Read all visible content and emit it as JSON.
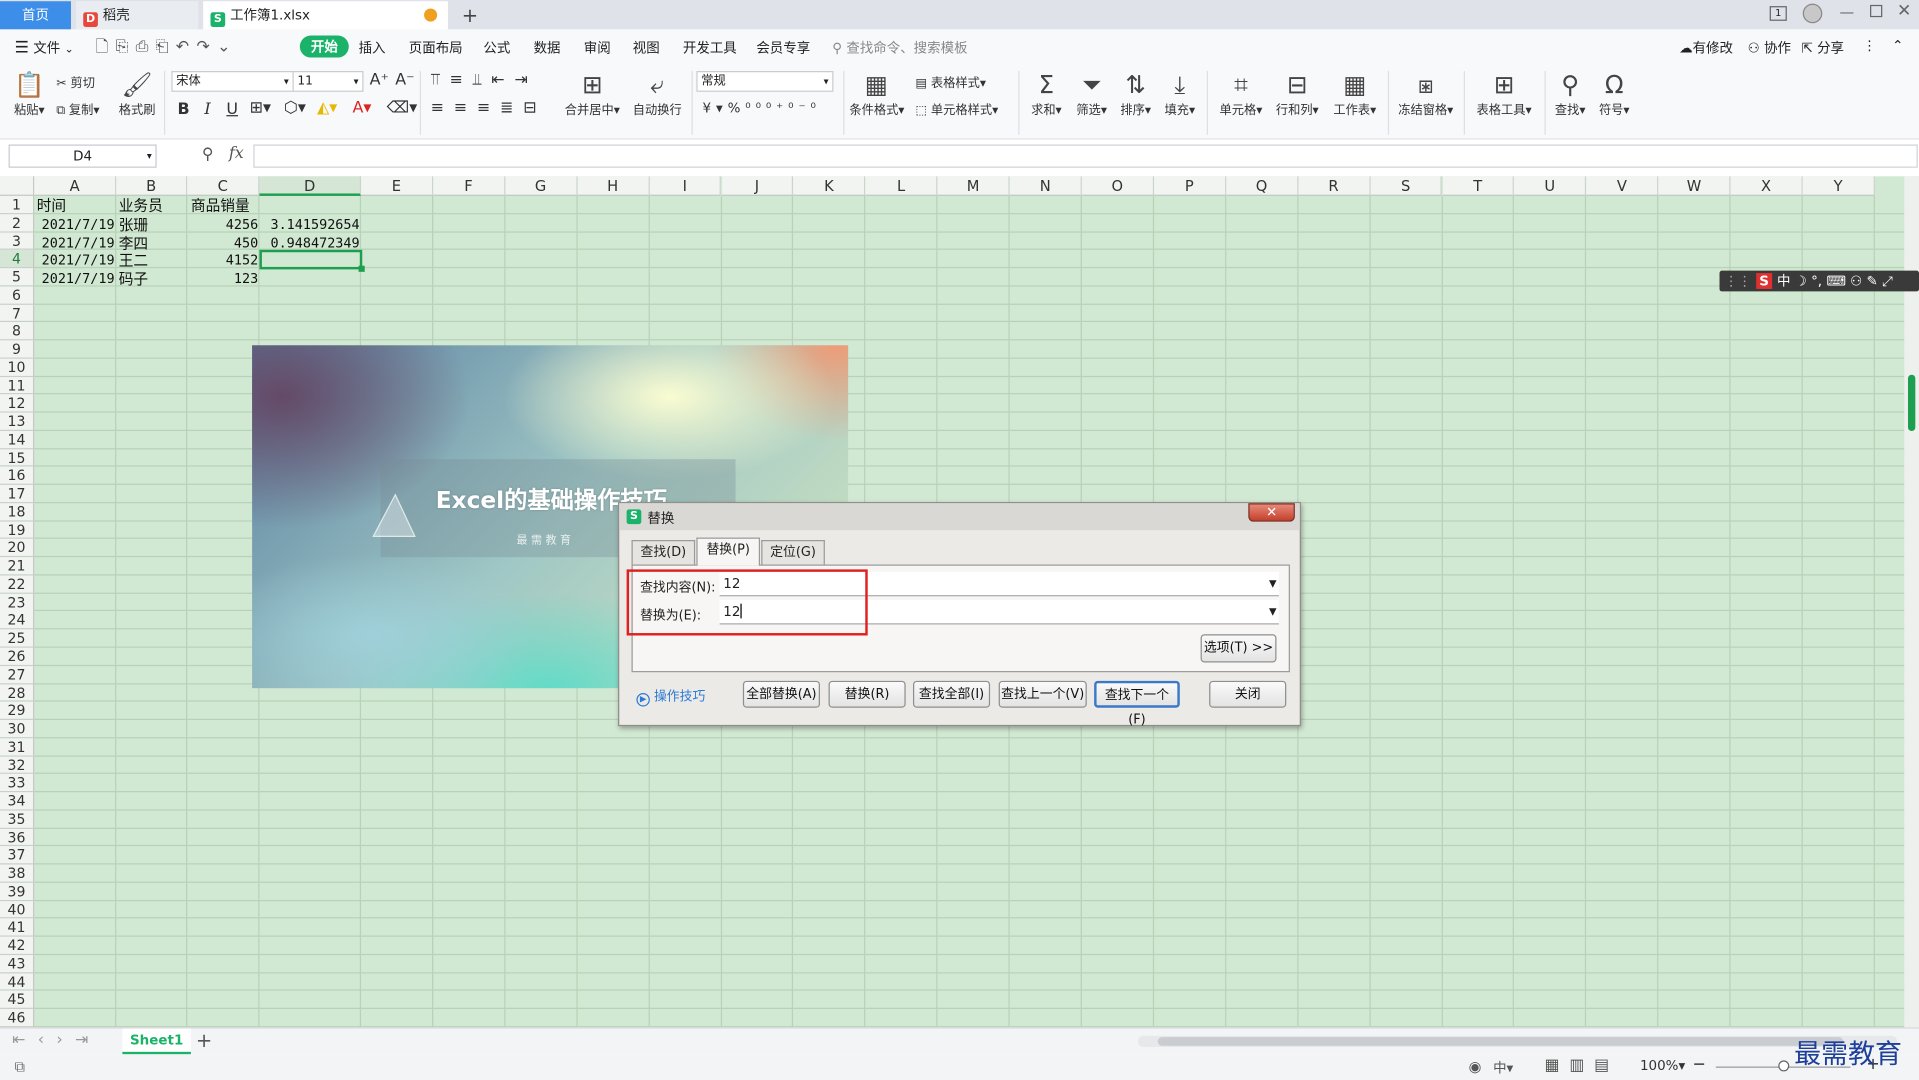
{
  "tabs": {
    "home": "首页",
    "docer": "稻壳",
    "file": "工作簿1.xlsx",
    "new_tab": "+"
  },
  "menu": {
    "file": "文件",
    "start": "开始",
    "insert": "插入",
    "layout": "页面布局",
    "formula": "公式",
    "data": "数据",
    "review": "审阅",
    "view": "视图",
    "dev": "开发工具",
    "member": "会员专享",
    "search_placeholder": "查找命令、搜索模板",
    "modified": "有修改",
    "collab": "协作",
    "share": "分享"
  },
  "ribbon": {
    "paste": "粘贴",
    "cut": "剪切",
    "copy": "复制",
    "format_painter": "格式刷",
    "font_name": "宋体",
    "font_size": "11",
    "bold": "B",
    "italic": "I",
    "underline": "U",
    "merge": "合并居中",
    "wrap": "自动换行",
    "number_format": "常规",
    "cond_format": "条件格式",
    "table_style": "表格样式",
    "cell_style": "单元格样式",
    "sum": "求和",
    "filter": "筛选",
    "sort": "排序",
    "fill": "填充",
    "cell": "单元格",
    "rowcol": "行和列",
    "sheet": "工作表",
    "freeze": "冻结窗格",
    "table_tools": "表格工具",
    "find": "查找",
    "symbol": "符号"
  },
  "formula_bar": {
    "name_box": "D4",
    "fx": "fx",
    "content": ""
  },
  "columns": [
    "A",
    "B",
    "C",
    "D",
    "E",
    "F",
    "G",
    "H",
    "I",
    "J",
    "K",
    "L",
    "M",
    "N",
    "O",
    "P",
    "Q",
    "R",
    "S",
    "T",
    "U",
    "V",
    "W",
    "X",
    "Y"
  ],
  "rows": [
    "1",
    "2",
    "3",
    "4",
    "5",
    "6",
    "7",
    "8",
    "9",
    "10",
    "11",
    "12",
    "13",
    "14",
    "15",
    "16",
    "17",
    "18",
    "19",
    "20",
    "21",
    "22",
    "23",
    "24",
    "25",
    "26",
    "27",
    "28",
    "29",
    "30",
    "31",
    "32",
    "33",
    "34",
    "35",
    "36",
    "37",
    "38",
    "39",
    "40",
    "41",
    "42",
    "43",
    "44",
    "45",
    "46"
  ],
  "cells": {
    "a1": "时间",
    "b1": "业务员",
    "c1": "商品销量",
    "a2": "2021/7/19",
    "b2": "张珊",
    "c2": "4256",
    "d2": "3.141592654",
    "a3": "2021/7/19",
    "b3": "李四",
    "c3": "450",
    "d3": "0.948472349",
    "a4": "2021/7/19",
    "b4": "王二",
    "c4": "4152",
    "a5": "2021/7/19",
    "b5": "码子",
    "c5": "123"
  },
  "picture": {
    "title": "Excel的基础操作技巧",
    "subtitle": "最 需 教 育"
  },
  "ime": {
    "label": "中"
  },
  "dialog": {
    "title": "替换",
    "tab_find": "查找(D)",
    "tab_replace": "替换(P)",
    "tab_goto": "定位(G)",
    "find_label": "查找内容(N):",
    "find_value": "12",
    "replace_label": "替换为(E):",
    "replace_value": "12",
    "options": "选项(T) >>",
    "tips": "操作技巧",
    "replace_all": "全部替换(A)",
    "replace": "替换(R)",
    "find_all": "查找全部(I)",
    "find_prev": "查找上一个(V)",
    "find_next": "查找下一个(F)",
    "close": "关闭"
  },
  "sheet": {
    "name": "Sheet1",
    "add": "+"
  },
  "status": {
    "zoom": "100%",
    "ime": "中"
  },
  "watermark": "最需教育",
  "colors": {
    "accent": "#1bb26a",
    "grid_bg": "#d1e8d2",
    "selection": "#1e9e4f",
    "highlight_box": "#e02020",
    "link": "#2a7ad6"
  }
}
